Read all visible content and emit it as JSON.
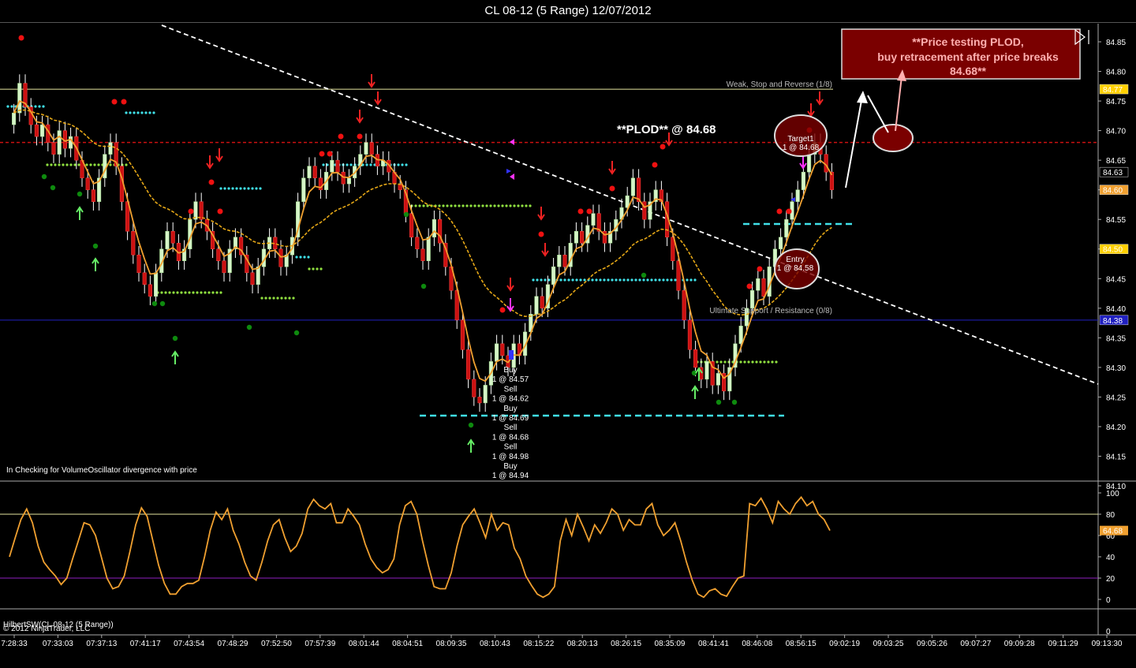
{
  "window": {
    "title": "CL 08-12 (5 Range)  12/07/2012"
  },
  "colors": {
    "background": "#000000",
    "up_candle": "#d6f5c8",
    "down_candle": "#cc1111",
    "fast_ma": "#f0a030",
    "slow_ma": "#e6a817",
    "plod_line": "#cc1111",
    "trend_line": "#ffffff",
    "support_line": "#2020c0",
    "weak_line": "#e6e6a0",
    "cyan_dots": "#40e0e8",
    "green_dots": "#90e040",
    "annotation_box": "#7a0000",
    "oscillator": "#f0a030"
  },
  "annotations": {
    "plod_label": "**PLOD** @ 84.68",
    "callout_box": [
      "**Price testing PLOD,",
      "buy retracement after price breaks",
      "84.68**"
    ],
    "weak_label": "Weak, Stop and Reverse (1/8)",
    "support_label": "Ultimate Support / Resistance (0/8)",
    "target_label": [
      "Target1",
      "1 @ 84.68"
    ],
    "entry_label": [
      "Entry",
      "1 @ 84.58"
    ],
    "trades_label": [
      "Buy",
      "1 @ 84.57",
      "Sell",
      "1 @ 84.62",
      "Buy",
      "1 @ 84.69",
      "Sell",
      "1 @ 84.68",
      "Sell",
      "1 @ 84.98",
      "Buy",
      "1 @ 84.94"
    ],
    "status_text": "In  Checking for VolumeOscillator divergence with price",
    "indicator_label": "HilbertSW(CL 08-12 (5 Range))",
    "copyright": "© 2012 NinjaTrader, LLC"
  },
  "chart_data": [
    {
      "type": "candlestick",
      "title": "CL 08-12 (5 Range)  12/07/2012",
      "ylim": [
        84.1,
        84.87
      ],
      "y_ticks": [
        "84.85",
        "84.80",
        "84.75",
        "84.70",
        "84.65",
        "84.60",
        "84.55",
        "84.50",
        "84.45",
        "84.40",
        "84.35",
        "84.30",
        "84.25",
        "84.20",
        "84.15",
        "84.10"
      ],
      "price_markers": [
        {
          "label": "84.77",
          "value": 84.77,
          "color": "#ffd000",
          "text_color": "#000000"
        },
        {
          "label": "84.63",
          "value": 84.63,
          "color": "#000000",
          "text_color": "#ffffff"
        },
        {
          "label": "84.60",
          "value": 84.6,
          "color": "#f0a030",
          "text_color": "#000000"
        },
        {
          "label": "84.50",
          "value": 84.5,
          "color": "#ffd000",
          "text_color": "#000000"
        },
        {
          "label": "84.38",
          "value": 84.38,
          "color": "#2020c0",
          "text_color": "#ffffff"
        }
      ],
      "x_ticks": [
        "7:28:33",
        "07:33:03",
        "07:37:13",
        "07:41:17",
        "07:43:54",
        "07:48:29",
        "07:52:50",
        "07:57:39",
        "08:01:44",
        "08:04:51",
        "08:09:35",
        "08:10:43",
        "08:15:22",
        "08:20:13",
        "08:26:15",
        "08:35:09",
        "08:41:41",
        "08:46:08",
        "08:56:15",
        "09:02:19",
        "09:03:25",
        "09:05:26",
        "09:07:27",
        "09:09:28",
        "09:11:29",
        "09:13:30"
      ],
      "levels": {
        "plod": 84.68,
        "weak": 84.77,
        "support": 84.38,
        "entry": 84.58,
        "target": 84.68
      },
      "close_series": [
        84.73,
        84.78,
        84.74,
        84.71,
        84.69,
        84.71,
        84.68,
        84.66,
        84.7,
        84.67,
        84.69,
        84.65,
        84.62,
        84.6,
        84.58,
        84.62,
        84.66,
        84.68,
        84.64,
        84.58,
        84.53,
        84.49,
        84.46,
        84.44,
        84.42,
        84.46,
        84.5,
        84.53,
        84.51,
        84.48,
        84.5,
        84.55,
        84.58,
        84.55,
        84.53,
        84.5,
        84.48,
        84.46,
        84.5,
        84.52,
        84.49,
        84.46,
        84.44,
        84.47,
        84.5,
        84.52,
        84.5,
        84.47,
        84.49,
        84.52,
        84.58,
        84.62,
        84.64,
        84.62,
        84.6,
        84.63,
        84.65,
        84.63,
        84.61,
        84.62,
        84.64,
        84.66,
        84.68,
        84.66,
        84.64,
        84.65,
        84.63,
        84.61,
        84.6,
        84.56,
        84.52,
        84.5,
        84.48,
        84.52,
        84.55,
        84.51,
        84.47,
        84.43,
        84.38,
        84.33,
        84.28,
        84.25,
        84.24,
        84.27,
        84.31,
        84.34,
        84.32,
        84.3,
        84.34,
        84.32,
        84.36,
        84.39,
        84.42,
        84.4,
        84.44,
        84.47,
        84.49,
        84.47,
        84.51,
        84.53,
        84.51,
        84.54,
        84.56,
        84.53,
        84.51,
        84.53,
        84.55,
        84.57,
        84.59,
        84.62,
        84.58,
        84.55,
        84.58,
        84.6,
        84.58,
        84.52,
        84.48,
        84.43,
        84.38,
        84.33,
        84.3,
        84.28,
        84.31,
        84.27,
        84.29,
        84.26,
        84.3,
        84.34,
        84.37,
        84.4,
        84.43,
        84.45,
        84.42,
        84.47,
        84.5,
        84.52,
        84.55,
        84.58,
        84.6,
        84.63,
        84.66,
        84.68,
        84.66,
        84.63,
        84.6
      ]
    },
    {
      "type": "line",
      "title": "HilbertSW(CL 08-12 (5 Range))",
      "ylim": [
        0,
        100
      ],
      "y_ticks": [
        "100",
        "80",
        "60",
        "40",
        "20",
        "0"
      ],
      "reference_levels": [
        80,
        20
      ],
      "last_value_label": "64.68",
      "last_value": 64.68,
      "series": [
        {
          "values": [
            40,
            58,
            75,
            85,
            72,
            50,
            35,
            28,
            22,
            14,
            20,
            38,
            55,
            72,
            70,
            60,
            40,
            20,
            10,
            12,
            22,
            45,
            70,
            86,
            78,
            55,
            32,
            15,
            5,
            5,
            12,
            15,
            15,
            18,
            40,
            65,
            82,
            75,
            85,
            65,
            52,
            35,
            22,
            18,
            35,
            55,
            70,
            75,
            58,
            45,
            50,
            62,
            85,
            94,
            88,
            85,
            90,
            72,
            72,
            85,
            78,
            70,
            52,
            38,
            30,
            25,
            28,
            38,
            70,
            88,
            92,
            80,
            55,
            32,
            12,
            10,
            10,
            25,
            50,
            70,
            78,
            85,
            72,
            58,
            80,
            65,
            72,
            70,
            48,
            38,
            22,
            13,
            5,
            2,
            5,
            12,
            55,
            75,
            60,
            80,
            68,
            55,
            70,
            62,
            72,
            85,
            80,
            65,
            75,
            70,
            70,
            85,
            90,
            70,
            60,
            65,
            72,
            55,
            35,
            18,
            5,
            2,
            8,
            10,
            5,
            3,
            12,
            20,
            22,
            90,
            88,
            95,
            85,
            72,
            92,
            85,
            80,
            90,
            96,
            88,
            92,
            80,
            75,
            64.68
          ]
        }
      ]
    }
  ]
}
